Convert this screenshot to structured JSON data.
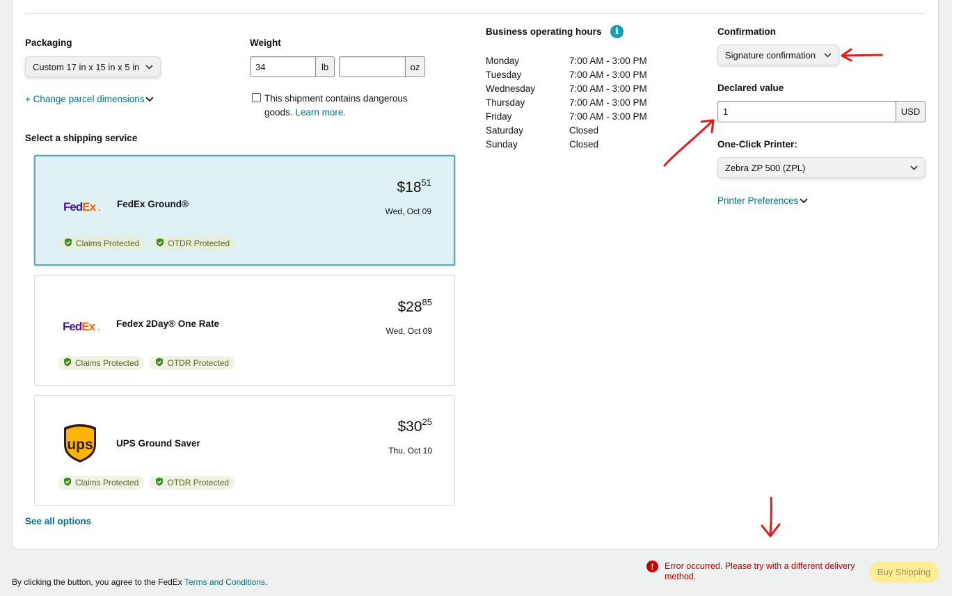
{
  "packaging": {
    "label": "Packaging",
    "selected": "Custom 17 in x 15 in x 5 in",
    "change_link": "+ Change parcel dimensions"
  },
  "weight": {
    "label": "Weight",
    "lb_value": "34",
    "lb_unit": "lb",
    "oz_value": "",
    "oz_unit": "oz",
    "dangerous_text": "This shipment contains dangerous goods.",
    "learn_more": "Learn more."
  },
  "shipping": {
    "section_title": "Select a shipping service",
    "services": [
      {
        "carrier": "FedEx",
        "name": "FedEx Ground®",
        "price_dollars": "$18",
        "price_cents": "51",
        "date": "Wed, Oct 09",
        "selected": true
      },
      {
        "carrier": "FedEx",
        "name": "Fedex 2Day® One Rate",
        "price_dollars": "$28",
        "price_cents": "85",
        "date": "Wed, Oct 09",
        "selected": false
      },
      {
        "carrier": "UPS",
        "name": "UPS Ground Saver",
        "price_dollars": "$30",
        "price_cents": "25",
        "date": "Thu, Oct 10",
        "selected": false
      }
    ],
    "badge_claims": "Claims Protected",
    "badge_otdr": "OTDR Protected",
    "see_all": "See all options"
  },
  "hours": {
    "title": "Business operating hours",
    "rows": [
      {
        "day": "Monday",
        "time": "7:00 AM - 3:00 PM"
      },
      {
        "day": "Tuesday",
        "time": "7:00 AM - 3:00 PM"
      },
      {
        "day": "Wednesday",
        "time": "7:00 AM - 3:00 PM"
      },
      {
        "day": "Thursday",
        "time": "7:00 AM - 3:00 PM"
      },
      {
        "day": "Friday",
        "time": "7:00 AM - 3:00 PM"
      },
      {
        "day": "Saturday",
        "time": "Closed"
      },
      {
        "day": "Sunday",
        "time": "Closed"
      }
    ]
  },
  "confirmation": {
    "label": "Confirmation",
    "selected": "Signature confirmation"
  },
  "declared": {
    "label": "Declared value",
    "value": "1",
    "currency": "USD"
  },
  "printer": {
    "label": "One-Click Printer:",
    "selected": "Zebra ZP 500 (ZPL)",
    "preferences_link": "Printer Preferences"
  },
  "footer": {
    "error": "Error occurred. Please try with a different delivery method.",
    "buy_button": "Buy Shipping",
    "agree_prefix": "By clicking the button, you agree to the FedEx ",
    "terms_link": "Terms and Conditions",
    "agree_suffix": "."
  },
  "colors": {
    "link": "#007185",
    "selected_bg": "#dff1f4",
    "error": "#c40000",
    "button_disabled": "#fcee95",
    "annotation": "#e01b1b"
  },
  "icons": [
    "info-icon",
    "chevron-down-icon",
    "shield-check-icon",
    "error-icon",
    "fedex-logo",
    "ups-logo"
  ]
}
